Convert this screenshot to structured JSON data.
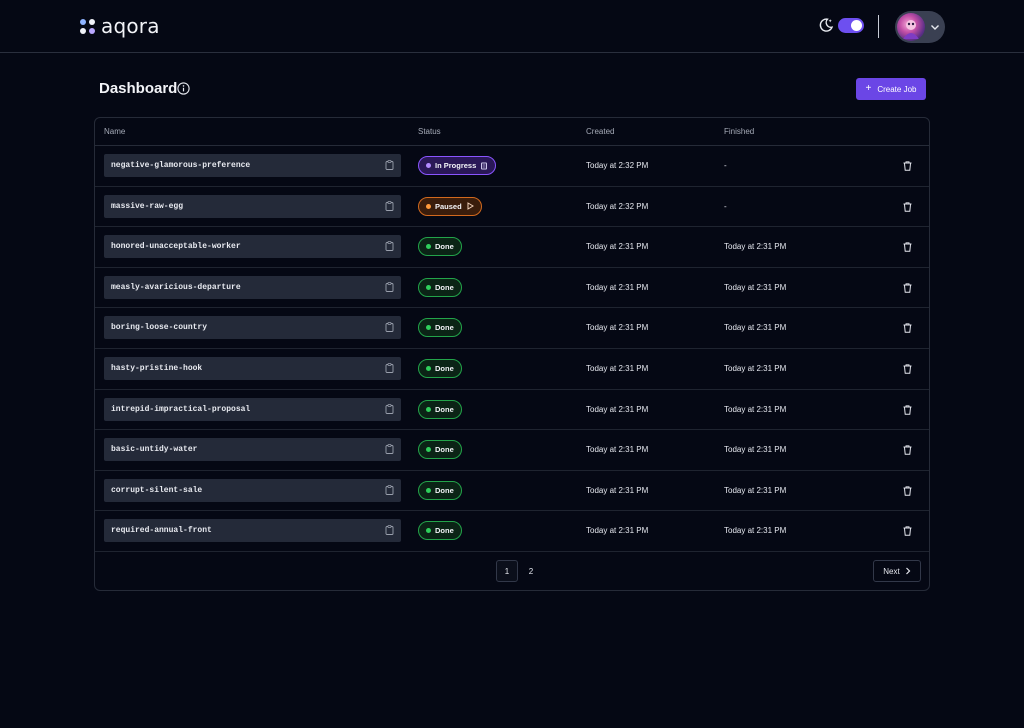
{
  "app": {
    "name": "aqora"
  },
  "header": {
    "theme_toggle_on": true,
    "theme_icon": "moon-icon",
    "avatar_icon": "avatar"
  },
  "page": {
    "title": "Dashboard",
    "create_label": "Create Job"
  },
  "table": {
    "columns": {
      "name": "Name",
      "status": "Status",
      "created": "Created",
      "finished": "Finished"
    },
    "rows": [
      {
        "name": "negative-glamorous-preference",
        "status": "In Progress",
        "status_kind": "progress",
        "created": "Today at 2:32 PM",
        "finished": "-"
      },
      {
        "name": "massive-raw-egg",
        "status": "Paused",
        "status_kind": "paused",
        "created": "Today at 2:32 PM",
        "finished": "-"
      },
      {
        "name": "honored-unacceptable-worker",
        "status": "Done",
        "status_kind": "done",
        "created": "Today at 2:31 PM",
        "finished": "Today at 2:31 PM"
      },
      {
        "name": "measly-avaricious-departure",
        "status": "Done",
        "status_kind": "done",
        "created": "Today at 2:31 PM",
        "finished": "Today at 2:31 PM"
      },
      {
        "name": "boring-loose-country",
        "status": "Done",
        "status_kind": "done",
        "created": "Today at 2:31 PM",
        "finished": "Today at 2:31 PM"
      },
      {
        "name": "hasty-pristine-hook",
        "status": "Done",
        "status_kind": "done",
        "created": "Today at 2:31 PM",
        "finished": "Today at 2:31 PM"
      },
      {
        "name": "intrepid-impractical-proposal",
        "status": "Done",
        "status_kind": "done",
        "created": "Today at 2:31 PM",
        "finished": "Today at 2:31 PM"
      },
      {
        "name": "basic-untidy-water",
        "status": "Done",
        "status_kind": "done",
        "created": "Today at 2:31 PM",
        "finished": "Today at 2:31 PM"
      },
      {
        "name": "corrupt-silent-sale",
        "status": "Done",
        "status_kind": "done",
        "created": "Today at 2:31 PM",
        "finished": "Today at 2:31 PM"
      },
      {
        "name": "required-annual-front",
        "status": "Done",
        "status_kind": "done",
        "created": "Today at 2:31 PM",
        "finished": "Today at 2:31 PM"
      }
    ]
  },
  "pagination": {
    "pages": [
      "1",
      "2"
    ],
    "current": "1",
    "next_label": "Next"
  },
  "colors": {
    "accent": "#6b46e6",
    "done": "#2fcf5c",
    "progress": "#8a55ff",
    "paused": "#ff9a3c",
    "background": "#050814"
  }
}
